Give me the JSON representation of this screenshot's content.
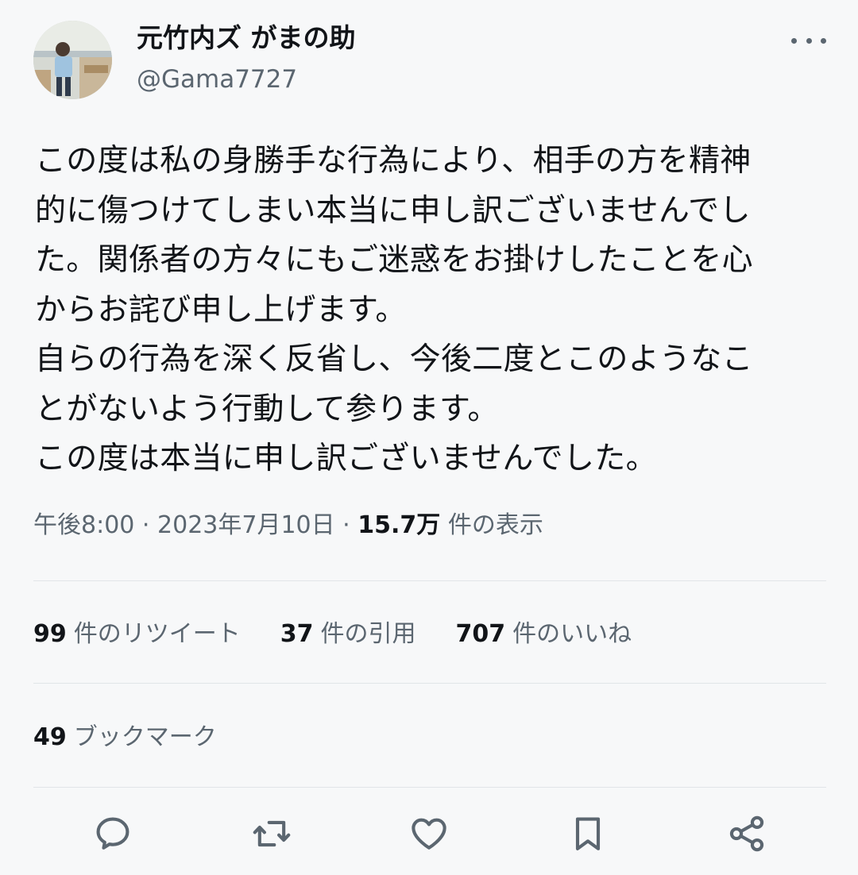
{
  "user": {
    "display_name": "元竹内ズ がまの助",
    "handle": "@Gama7727"
  },
  "tweet": {
    "lines": [
      "この度は私の身勝手な行為により、相手の方を精神",
      "的に傷つけてしまい本当に申し訳ございませんでし",
      "た。関係者の方々にもご迷惑をお掛けしたことを心",
      "からお詫び申し上げます。",
      "自らの行為を深く反省し、今後二度とこのようなこ",
      "とがないよう行動して参ります。",
      "この度は本当に申し訳ございませんでした。"
    ]
  },
  "meta": {
    "time": "午後8:00",
    "separator": "·",
    "date": "2023年7月10日",
    "views_count": "15.7万",
    "views_label": "件の表示"
  },
  "stats": {
    "retweets_count": "99",
    "retweets_label": "件のリツイート",
    "quotes_count": "37",
    "quotes_label": "件の引用",
    "likes_count": "707",
    "likes_label": "件のいいね",
    "bookmarks_count": "49",
    "bookmarks_label": "ブックマーク"
  },
  "icons": {
    "more": "more-icon",
    "reply": "reply-icon",
    "retweet": "retweet-icon",
    "like": "heart-icon",
    "bookmark": "bookmark-icon",
    "share": "share-icon"
  },
  "colors": {
    "text_primary": "#111418",
    "text_secondary": "#5b6670",
    "background": "#f7f8f9",
    "divider": "#e1e5e8"
  }
}
